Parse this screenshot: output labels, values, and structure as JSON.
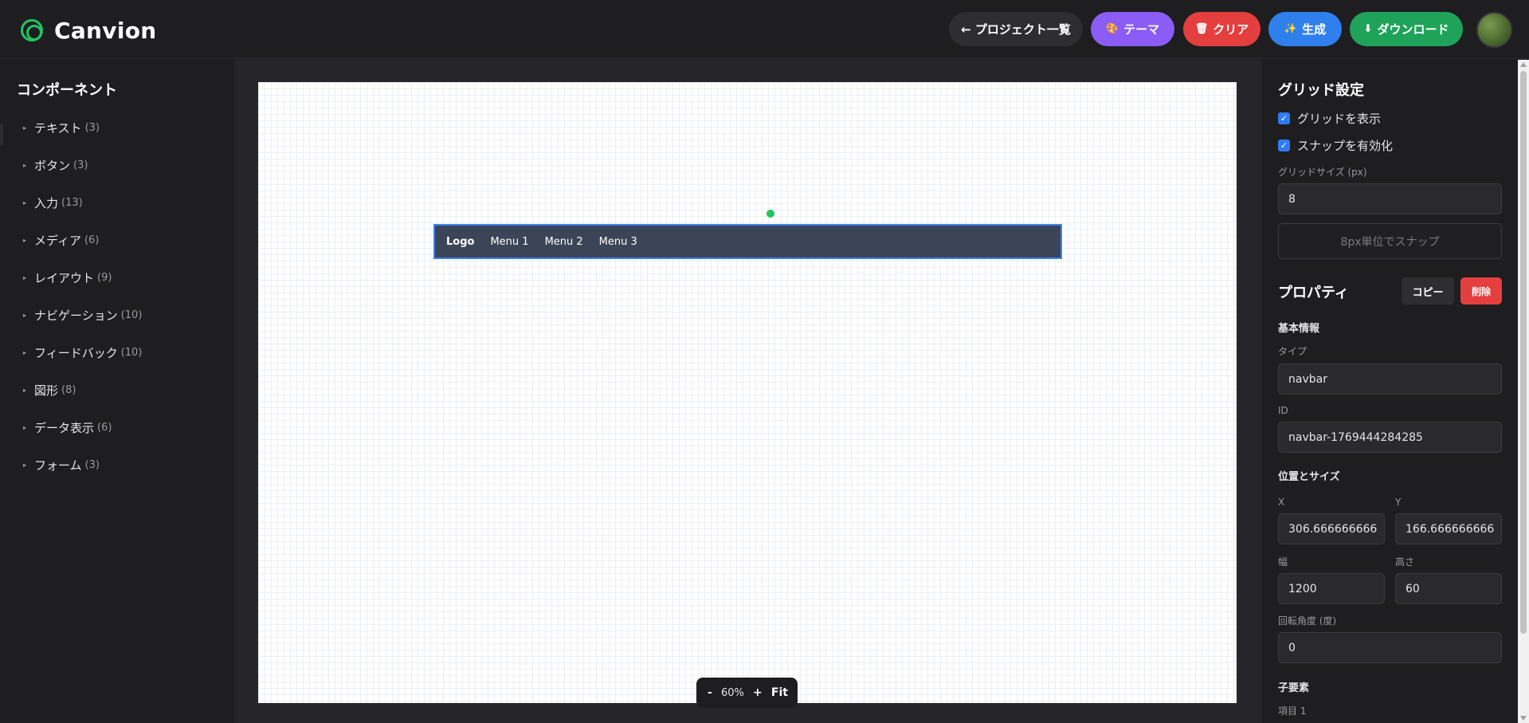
{
  "app": {
    "name": "Canvion"
  },
  "header": {
    "buttons": {
      "projects": "← プロジェクト一覧",
      "theme": "テーマ",
      "clear": "クリア",
      "generate": "生成",
      "download": "ダウンロード"
    },
    "icons": {
      "theme": "palette-icon",
      "clear": "trash-icon",
      "generate": "sparkle-icon",
      "download": "download-icon"
    }
  },
  "sidebar": {
    "title": "コンポーネント",
    "categories": [
      {
        "label": "テキスト",
        "count": "(3)"
      },
      {
        "label": "ボタン",
        "count": "(3)"
      },
      {
        "label": "入力",
        "count": "(13)"
      },
      {
        "label": "メディア",
        "count": "(6)"
      },
      {
        "label": "レイアウト",
        "count": "(9)"
      },
      {
        "label": "ナビゲーション",
        "count": "(10)"
      },
      {
        "label": "フィードバック",
        "count": "(10)"
      },
      {
        "label": "図形",
        "count": "(8)"
      },
      {
        "label": "データ表示",
        "count": "(6)"
      },
      {
        "label": "フォーム",
        "count": "(3)"
      }
    ]
  },
  "canvas": {
    "navbar": {
      "logo": "Logo",
      "menus": [
        "Menu 1",
        "Menu 2",
        "Menu 3"
      ]
    },
    "zoom": {
      "minus": "-",
      "value": "60%",
      "plus": "+",
      "fit": "Fit"
    }
  },
  "grid": {
    "title": "グリッド設定",
    "show_grid": "グリッドを表示",
    "enable_snap": "スナップを有効化",
    "size_label": "グリッドサイズ (px)",
    "size_value": "8",
    "snap_button": "8px単位でスナップ"
  },
  "properties": {
    "title": "プロパティ",
    "copy": "コピー",
    "delete": "削除",
    "basic_info": "基本情報",
    "type_label": "タイプ",
    "type_value": "navbar",
    "id_label": "ID",
    "id_value": "navbar-1769444284285",
    "pos_size": "位置とサイズ",
    "x_label": "X",
    "x_value": "306.666666666",
    "y_label": "Y",
    "y_value": "166.666666666",
    "width_label": "幅",
    "width_value": "1200",
    "height_label": "高さ",
    "height_value": "60",
    "rotation_label": "回転角度 (度)",
    "rotation_value": "0",
    "children": "子要素",
    "item1": "項目 1"
  },
  "colors": {
    "brand": "#22c55e",
    "theme_btn": "#8b5cf6",
    "clear_btn": "#e53e3e",
    "generate_btn": "#2f80ed",
    "download_btn": "#1fa35a",
    "selection": "#3b82f6",
    "navbar_bg": "#3b4557"
  }
}
